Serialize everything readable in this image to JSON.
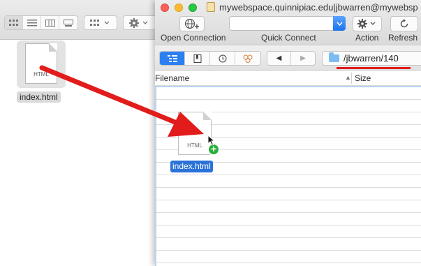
{
  "finder": {
    "file": {
      "name": "index.html",
      "badge": "HTML"
    }
  },
  "window": {
    "title": "mywebspace.quinnipiac.edu|jbwarren@mywebsp"
  },
  "toolbar": {
    "open_connection_label": "Open Connection",
    "quick_connect_label": "Quick Connect",
    "quick_connect_value": "",
    "action_label": "Action",
    "refresh_label": "Refresh"
  },
  "navigation": {
    "path": "/jbwarren/140"
  },
  "table": {
    "columns": {
      "filename": "Filename",
      "size": "Size"
    },
    "rows": []
  },
  "drag": {
    "file_name": "index.html",
    "badge": "HTML"
  },
  "colors": {
    "annotation_red": "#e21b1b",
    "selection_blue": "#2b72d9",
    "add_badge_green": "#27b03b"
  },
  "icons": [
    "gear-icon",
    "refresh-icon",
    "globe-plus-icon",
    "folder-icon",
    "bookmark-icon",
    "history-icon",
    "bonjour-icon",
    "list-icon",
    "back-icon",
    "forward-icon"
  ]
}
